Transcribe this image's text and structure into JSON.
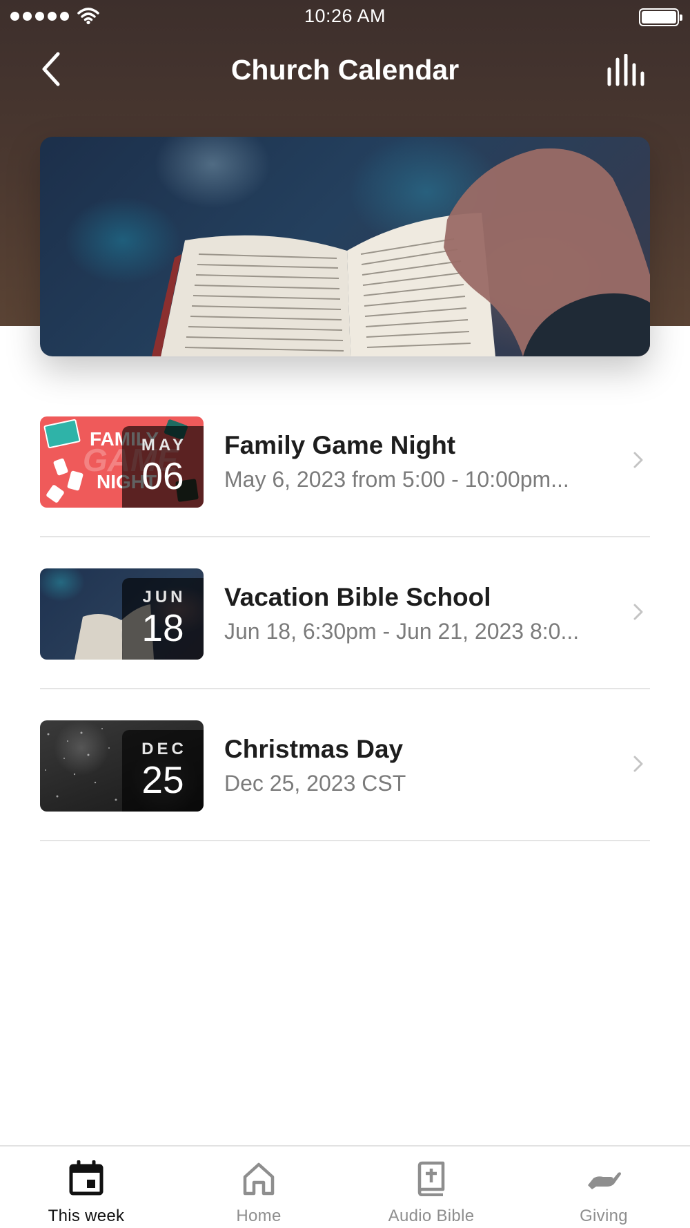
{
  "status_bar": {
    "time": "10:26 AM",
    "signal_icon": "signal-dots-icon",
    "wifi_icon": "wifi-icon",
    "battery_icon": "battery-icon"
  },
  "nav": {
    "title": "Church Calendar",
    "back_icon": "chevron-left-icon",
    "action_icon": "audio-bars-icon"
  },
  "hero": {
    "image": "open-bible-photo"
  },
  "events": [
    {
      "month": "MAY",
      "day": "06",
      "title": "Family Game Night",
      "subtitle": "May 6, 2023 from 5:00 - 10:00pm...",
      "thumb_text": [
        "FAMILY",
        "GAME",
        "NIGHT"
      ]
    },
    {
      "month": "JUN",
      "day": "18",
      "title": "Vacation Bible School",
      "subtitle": "Jun 18, 6:30pm - Jun 21, 2023 8:0..."
    },
    {
      "month": "DEC",
      "day": "25",
      "title": "Christmas Day",
      "subtitle": "Dec 25, 2023 CST"
    }
  ],
  "tabs": [
    {
      "label": "This week",
      "icon": "calendar-icon",
      "active": true
    },
    {
      "label": "Home",
      "icon": "home-icon",
      "active": false
    },
    {
      "label": "Audio Bible",
      "icon": "bible-icon",
      "active": false
    },
    {
      "label": "Giving",
      "icon": "giving-hand-icon",
      "active": false
    }
  ],
  "colors": {
    "header_bg": "#4c3930",
    "active_tab": "#111111",
    "inactive_tab": "#8e8e8e",
    "subtitle": "#7b7b7b"
  }
}
